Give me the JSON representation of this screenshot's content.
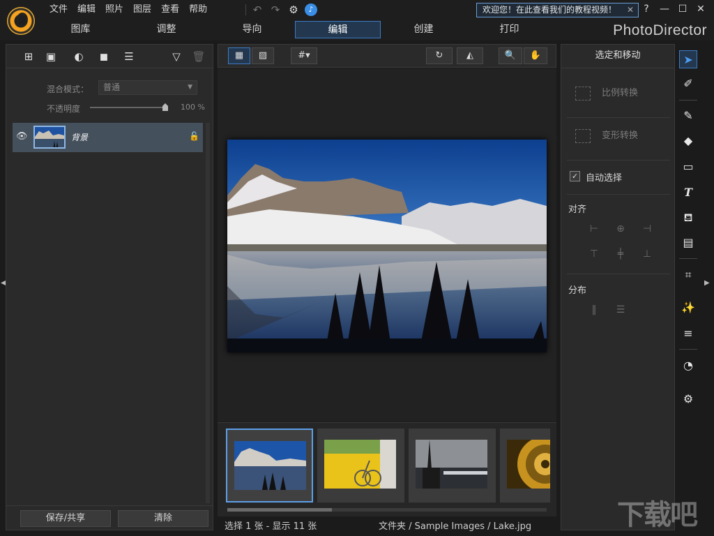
{
  "menu": {
    "items": [
      "文件",
      "编辑",
      "照片",
      "图层",
      "查看",
      "帮助"
    ]
  },
  "notification": {
    "welcome_text": "欢迎您！在此查看我们的教程视频！",
    "close": "✕"
  },
  "window": {
    "help": "?",
    "minimize": "—",
    "maximize": "☐",
    "close": "✕"
  },
  "mode_tabs": {
    "tabs": [
      "图库",
      "调整",
      "导向",
      "编辑",
      "创建",
      "打印"
    ],
    "active": "编辑"
  },
  "brand": "PhotoDirector",
  "layers_panel": {
    "blend_mode_label": "混合模式：",
    "blend_mode_value": "普通",
    "opacity_label": "不透明度",
    "opacity_value": "100 %",
    "opacity_level": 1.0,
    "layer_name": "背景",
    "save_share_button": "保存/共享",
    "clear_button": "清除"
  },
  "right_panel": {
    "title": "选定和移动",
    "scale_transform": "比例转换",
    "free_transform": "变形转换",
    "auto_select_label": "自动选择",
    "auto_select_checked": true,
    "align_label": "对齐",
    "distribute_label": "分布"
  },
  "status": {
    "selection_text": "选择 1 张 - 显示 11 张",
    "path_text": "文件夹 / Sample Images / Lake.jpg"
  },
  "watermark": "下载吧",
  "colors": {
    "accent": "#3d7bc4",
    "active_tool": "#4d9cf2",
    "bell": "#3a8ee6",
    "logo": "#f4a21f"
  }
}
